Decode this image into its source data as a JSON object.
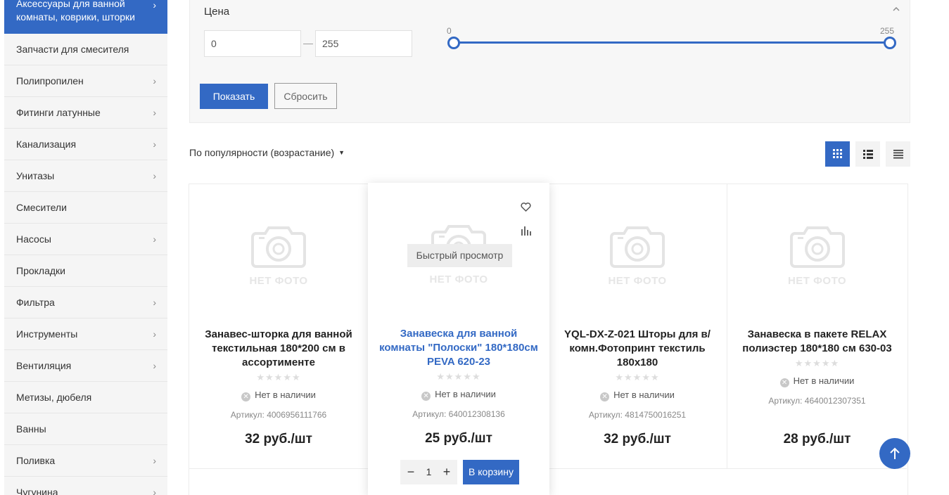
{
  "sidebar": {
    "active": {
      "label": "Аксессуары для ванной комнаты, коврики, шторки"
    },
    "items": [
      {
        "label": "Запчасти для смесителя",
        "has_children": false
      },
      {
        "label": "Полипропилен",
        "has_children": true
      },
      {
        "label": "Фитинги латунные",
        "has_children": true
      },
      {
        "label": "Канализация",
        "has_children": true
      },
      {
        "label": "Унитазы",
        "has_children": true
      },
      {
        "label": "Смесители",
        "has_children": false
      },
      {
        "label": "Насосы",
        "has_children": true
      },
      {
        "label": "Прокладки",
        "has_children": false
      },
      {
        "label": "Фильтра",
        "has_children": true
      },
      {
        "label": "Инструменты",
        "has_children": true
      },
      {
        "label": "Вентиляция",
        "has_children": true
      },
      {
        "label": "Метизы, дюбеля",
        "has_children": false
      },
      {
        "label": "Ванны",
        "has_children": false
      },
      {
        "label": "Поливка",
        "has_children": true
      },
      {
        "label": "Чугунина",
        "has_children": true
      }
    ]
  },
  "filter": {
    "title": "Цена",
    "from_value": "0",
    "to_value": "255",
    "dash": "—",
    "slider_min_label": "0",
    "slider_max_label": "255",
    "show_label": "Показать",
    "reset_label": "Сбросить"
  },
  "sort": {
    "label": "По популярности (возрастание)"
  },
  "products": [
    {
      "title": "Занавес-шторка для ванной текстильная 180*200 см в ассортименте",
      "stock": "Нет в наличии",
      "sku": "Артикул: 4006956111766",
      "price": "32 руб./шт",
      "no_photo": "НЕТ ФОТО"
    },
    {
      "title": "Занавеска для ванной комнаты \"Полоски\" 180*180см PEVA 620-23",
      "stock": "Нет в наличии",
      "sku": "Артикул: 640012308136",
      "price": "25 руб./шт",
      "no_photo": "НЕТ ФОТО",
      "quick_view": "Быстрый просмотр",
      "qty": "1",
      "cart_label": "В корзину"
    },
    {
      "title": "YQL-DX-Z-021 Шторы для в/комн.Фотопринт текстиль 180х180",
      "stock": "Нет в наличии",
      "sku": "Артикул: 4814750016251",
      "price": "32 руб./шт",
      "no_photo": "НЕТ ФОТО"
    },
    {
      "title": "Занавеска в пакете RELAX полиэстер 180*180 см 630-03",
      "stock": "Нет в наличии",
      "sku": "Артикул: 4640012307351",
      "price": "28 руб./шт",
      "no_photo": "НЕТ ФОТО"
    }
  ],
  "colors": {
    "accent": "#3369c4",
    "sidebar_bg": "#f5f5f5"
  }
}
